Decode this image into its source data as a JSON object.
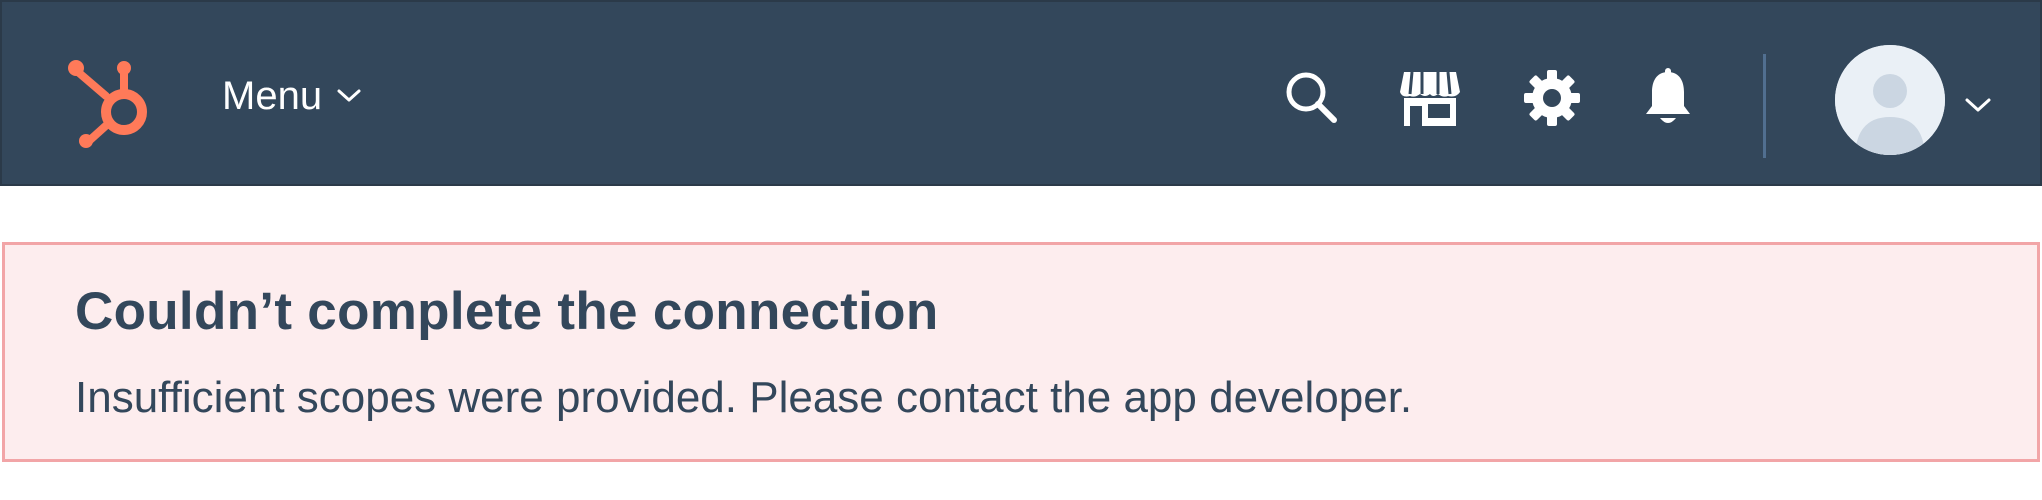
{
  "navbar": {
    "logo_icon": "hubspot-sprocket-icon",
    "menu_label": "Menu",
    "menu_caret_icon": "chevron-down-icon",
    "icons": {
      "search": "search-icon",
      "marketplace": "marketplace-storefront-icon",
      "settings": "gear-icon",
      "notifications": "bell-icon"
    },
    "avatar_icon": "user-avatar-icon",
    "account_caret_icon": "chevron-down-icon"
  },
  "alert": {
    "title": "Couldn’t complete the connection",
    "message": "Insufficient scopes were provided. Please contact the app developer."
  },
  "colors": {
    "navbar_bg": "#33475b",
    "brand_orange": "#ff7a59",
    "alert_bg": "#fdedee",
    "alert_border": "#f2a5a7",
    "text": "#33475b"
  }
}
